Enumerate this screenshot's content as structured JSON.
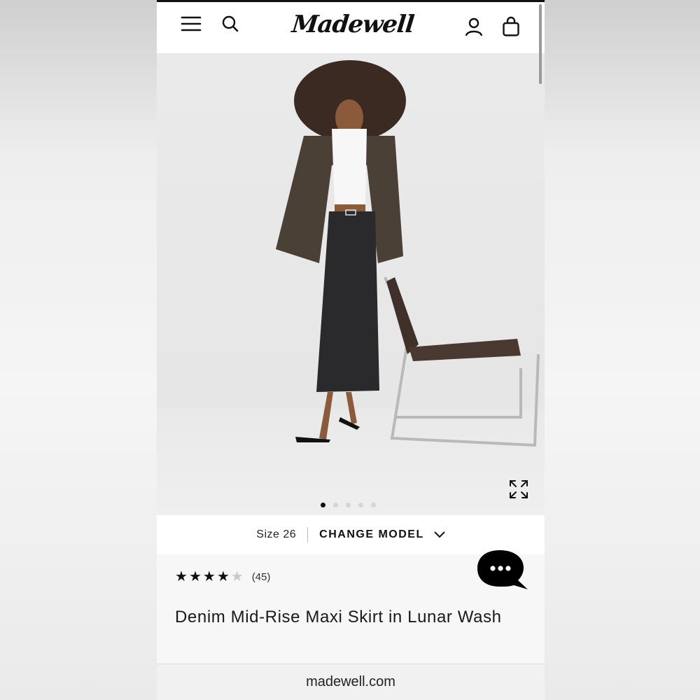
{
  "header": {
    "logo_text": "Madewell",
    "icons": [
      "menu-icon",
      "search-icon",
      "account-icon",
      "bag-icon"
    ]
  },
  "gallery": {
    "image_alt": "Model wearing denim maxi skirt, white crop top and leather jacket beside a chrome chair",
    "total_images": 5,
    "active_index": 0
  },
  "model_bar": {
    "size_label": "Size 26",
    "change_model_label": "CHANGE MODEL"
  },
  "product": {
    "rating": 4,
    "rating_max": 5,
    "review_count": "(45)",
    "title": "Denim Mid-Rise Maxi Skirt in Lunar Wash"
  },
  "browser": {
    "url": "madewell.com"
  },
  "colors": {
    "text": "#111111",
    "star_empty": "#c9c9c9",
    "chat_bubble": "#000000"
  }
}
